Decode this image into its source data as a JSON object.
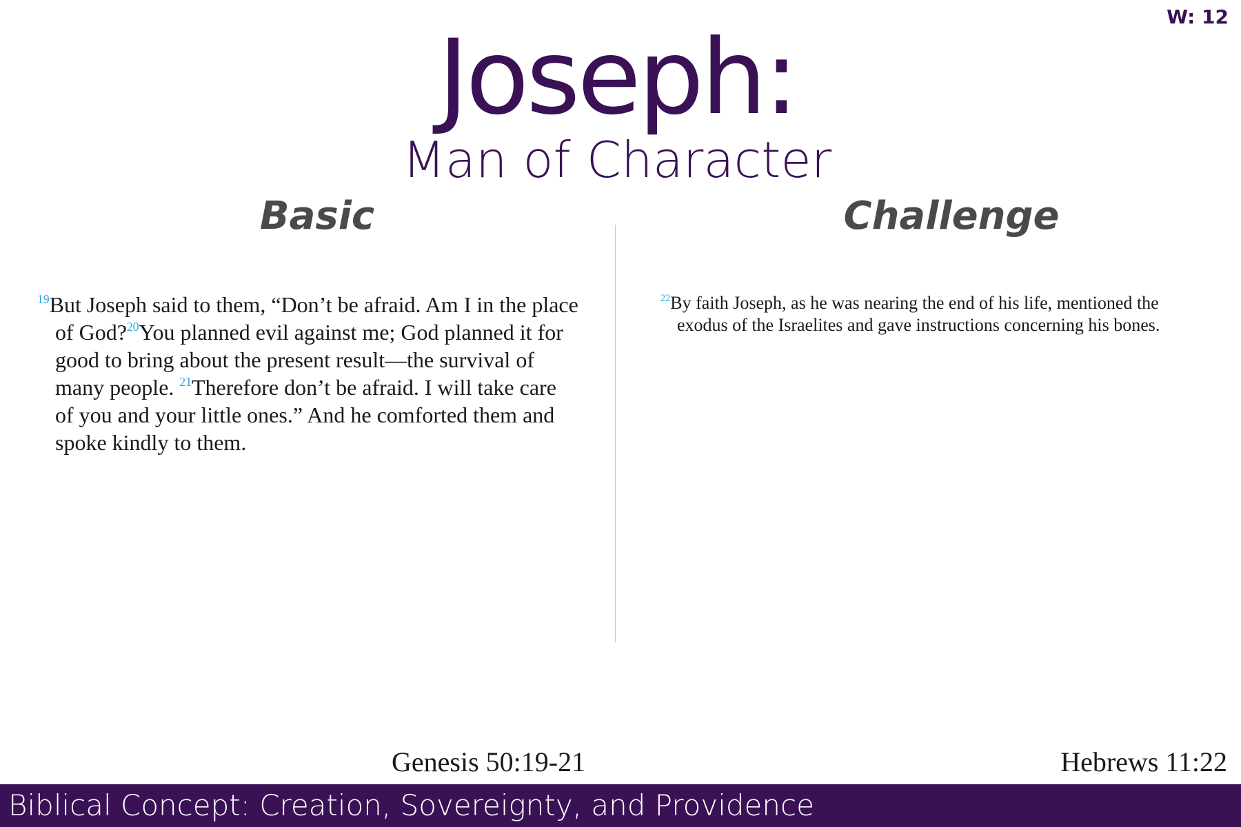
{
  "week": "W: 12",
  "title": "Joseph:",
  "subtitle": "Man of Character",
  "columns": {
    "left": {
      "heading": "Basic",
      "verses": [
        {
          "number": "19",
          "text": "But Joseph said to them, “Don’t be afraid. Am I in the place of God?"
        },
        {
          "number": "20",
          "text": "You planned evil against me; God planned it for good to bring about the present result—the survival of many people. "
        },
        {
          "number": "21",
          "text": "Therefore don’t be afraid. I will take care of you and your little ones.” And he comforted them and spoke kindly to them."
        }
      ],
      "reference": "Genesis 50:19-21"
    },
    "right": {
      "heading": "Challenge",
      "verses": [
        {
          "number": "22",
          "text": "By faith Joseph, as he was nearing the end of his life, mentioned the exodus of the Israelites and gave instructions concerning his bones."
        }
      ],
      "reference": "Hebrews 11:22"
    }
  },
  "footer": {
    "text": "Biblical Concept: Creation, Sovereignty, and Providence"
  },
  "colors": {
    "brand_purple": "#3b1155",
    "verse_number_blue": "#29a8e0",
    "heading_gray": "#4a4a4a",
    "divider_gray": "#c8c8c8"
  }
}
